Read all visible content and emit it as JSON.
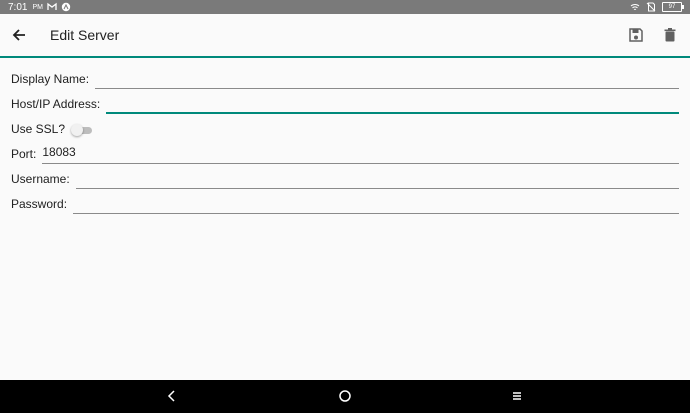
{
  "status_bar": {
    "time": "7:01",
    "ampm": "PM",
    "battery": "97"
  },
  "app_bar": {
    "title": "Edit Server"
  },
  "form": {
    "display_name": {
      "label": "Display Name:",
      "value": ""
    },
    "host": {
      "label": "Host/IP Address:",
      "value": ""
    },
    "use_ssl": {
      "label": "Use SSL?",
      "checked": false
    },
    "port": {
      "label": "Port:",
      "value": "18083"
    },
    "username": {
      "label": "Username:",
      "value": ""
    },
    "password": {
      "label": "Password:",
      "value": ""
    }
  },
  "colors": {
    "accent": "#00897b",
    "background": "#fafafa",
    "status_bar": "#7a7a7a",
    "nav_bar": "#000000"
  },
  "icons": {
    "back": "arrow-back-icon",
    "save": "floppy-disk-icon",
    "delete": "trash-icon",
    "nav_back": "chevron-left-icon",
    "nav_home": "circle-home-icon",
    "nav_recents": "menu-lines-icon"
  }
}
